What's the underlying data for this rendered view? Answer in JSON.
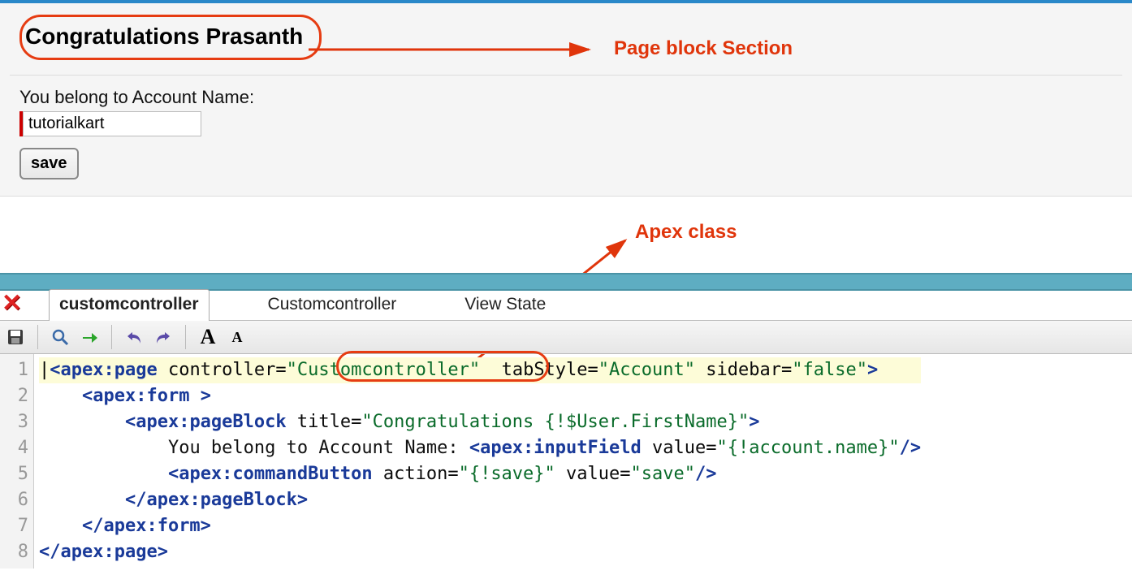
{
  "pageblock": {
    "title": "Congratulations Prasanth",
    "label": "You belong to Account Name:",
    "account_value": "tutorialkart",
    "save_label": "save"
  },
  "annotations": {
    "pageblock_section": "Page block Section",
    "apex_class": "Apex class"
  },
  "dev": {
    "tabs": {
      "t1": "customcontroller",
      "t2": "Customcontroller",
      "t3": "View State"
    },
    "gutter": [
      "1",
      "2",
      "3",
      "4",
      "5",
      "6",
      "7",
      "8"
    ],
    "code": {
      "l1": {
        "open": "<apex:page ",
        "a1": "controller=",
        "v1": "\"",
        "v1b": "Customcontroller",
        "v1c": "\"",
        "sp": "  ",
        "a2": "tabStyle=",
        "v2": "\"Account\"",
        "a3": " sidebar=",
        "v3": "\"false\"",
        "close": ">"
      },
      "l2": {
        "indent": "    ",
        "tag": "<apex:form ",
        "close": ">"
      },
      "l3": {
        "indent": "        ",
        "tag": "<apex:pageBlock ",
        "a1": "title=",
        "v1": "\"Congratulations {!$User.FirstName}\"",
        "close": ">"
      },
      "l4": {
        "indent": "            ",
        "txt": "You belong to Account Name: ",
        "tag": "<apex:inputField ",
        "a1": "value=",
        "v1": "\"{!account.name}\"",
        "close": "/>"
      },
      "l5": {
        "indent": "            ",
        "tag": "<apex:commandButton ",
        "a1": "action=",
        "v1": "\"{!save}\"",
        "a2": " value=",
        "v2": "\"save\"",
        "close": "/>"
      },
      "l6": {
        "indent": "        ",
        "tag": "</apex:pageBlock>"
      },
      "l7": {
        "indent": "    ",
        "tag": "</apex:form>"
      },
      "l8": {
        "tag": "</apex:page>"
      }
    }
  }
}
